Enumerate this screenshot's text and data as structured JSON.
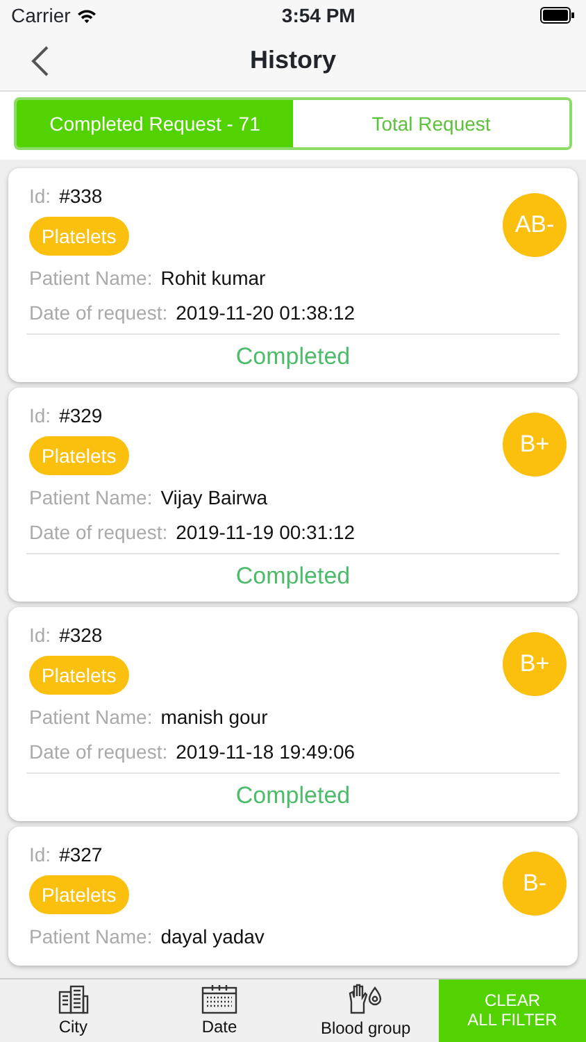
{
  "status_bar": {
    "carrier": "Carrier",
    "time": "3:54 PM"
  },
  "nav": {
    "title": "History"
  },
  "tabs": [
    {
      "label": "Completed Request - 71",
      "selected": true
    },
    {
      "label": "Total Request",
      "selected": false
    }
  ],
  "requests": [
    {
      "id_label": "Id:",
      "id": "#338",
      "type": "Platelets",
      "blood_group": "AB-",
      "name_label": "Patient Name:",
      "patient": "Rohit kumar",
      "date_label": "Date of request:",
      "date": "2019-11-20 01:38:12",
      "status": "Completed"
    },
    {
      "id_label": "Id:",
      "id": "#329",
      "type": "Platelets",
      "blood_group": "B+",
      "name_label": "Patient Name:",
      "patient": "Vijay Bairwa",
      "date_label": "Date of request:",
      "date": "2019-11-19 00:31:12",
      "status": "Completed"
    },
    {
      "id_label": "Id:",
      "id": "#328",
      "type": "Platelets",
      "blood_group": "B+",
      "name_label": "Patient Name:",
      "patient": "manish gour",
      "date_label": "Date of request:",
      "date": "2019-11-18 19:49:06",
      "status": "Completed"
    },
    {
      "id_label": "Id:",
      "id": "#327",
      "type": "Platelets",
      "blood_group": "B-",
      "name_label": "Patient Name:",
      "patient": "dayal yadav"
    }
  ],
  "filters": [
    {
      "kind": "city",
      "label": "City"
    },
    {
      "kind": "date",
      "label": "Date"
    },
    {
      "kind": "blood",
      "label": "Blood group"
    }
  ],
  "clear_button": {
    "line1": "CLEAR",
    "line2": "ALL FILTER"
  }
}
